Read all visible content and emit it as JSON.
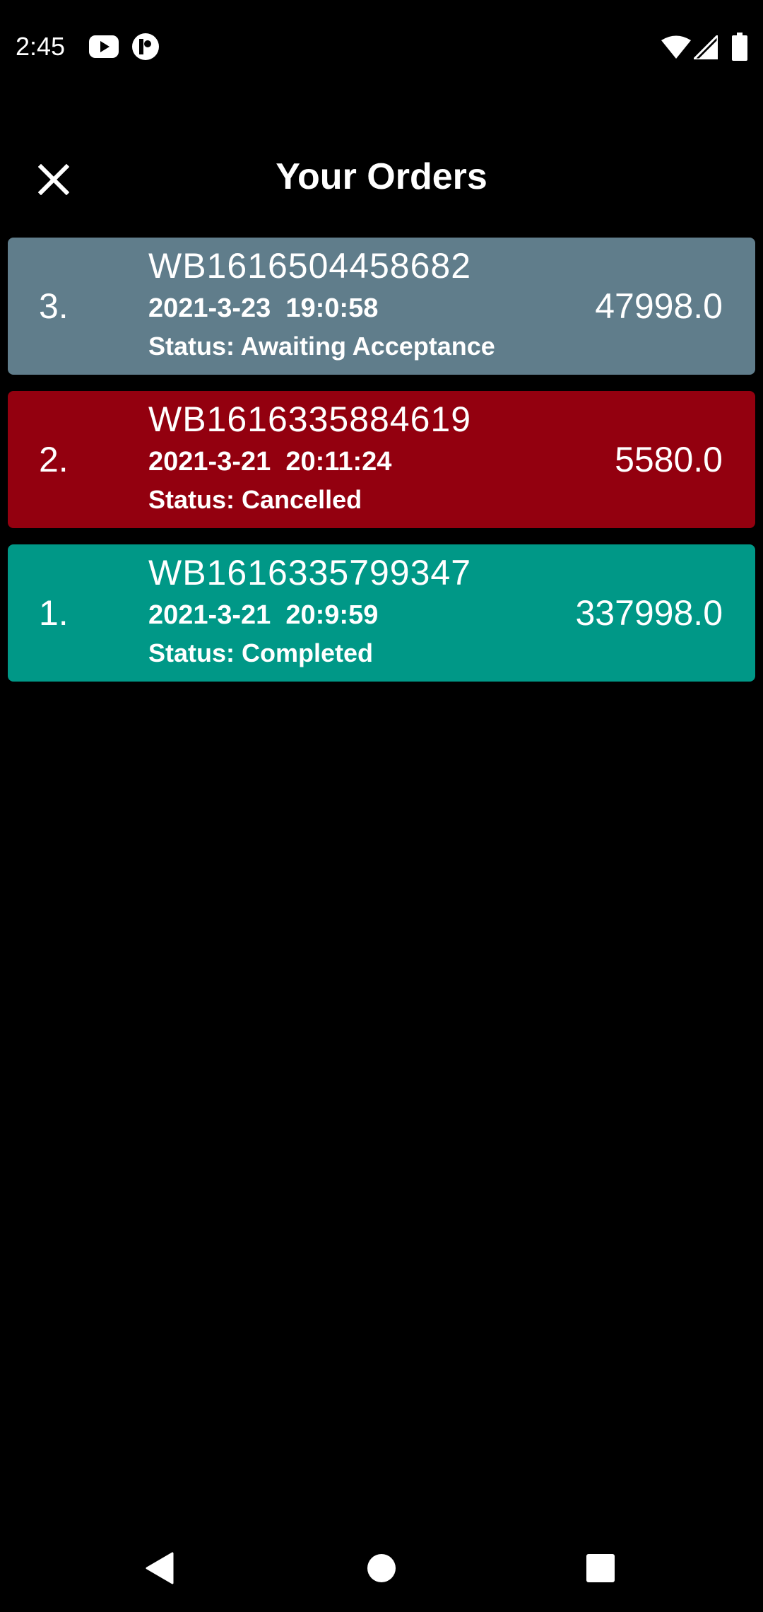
{
  "status_bar": {
    "time": "2:45",
    "icons": [
      "youtube-icon",
      "pi-app-icon",
      "wifi-icon",
      "cell-signal-icon",
      "battery-icon"
    ]
  },
  "app_bar": {
    "title": "Your Orders",
    "close_icon": "close-icon"
  },
  "orders": [
    {
      "index": "3.",
      "id": "WB1616504458682",
      "datetime": "2021-3-23  19:0:58",
      "status": "Status: Awaiting Acceptance",
      "amount": "47998.0",
      "color": "#607D8B"
    },
    {
      "index": "2.",
      "id": "WB1616335884619",
      "datetime": "2021-3-21  20:11:24",
      "status": "Status: Cancelled",
      "amount": "5580.0",
      "color": "#93000F"
    },
    {
      "index": "1.",
      "id": "WB1616335799347",
      "datetime": "2021-3-21  20:9:59",
      "status": "Status: Completed",
      "amount": "337998.0",
      "color": "#009887"
    }
  ],
  "nav_bar": {
    "icons": [
      "back-icon",
      "home-icon",
      "recents-icon"
    ]
  }
}
